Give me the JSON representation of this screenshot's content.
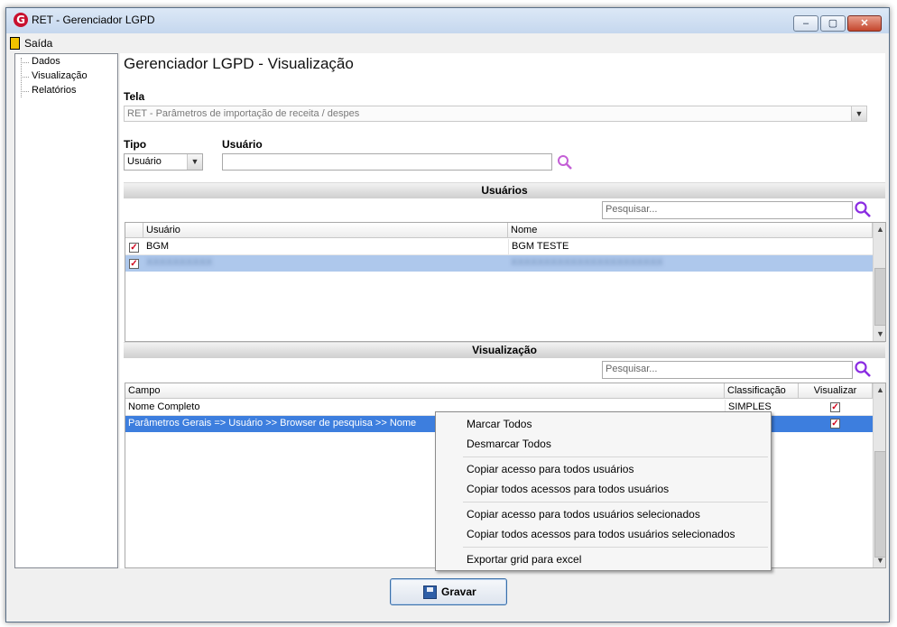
{
  "window": {
    "title": "RET - Gerenciador LGPD",
    "app_icon_letter": "G",
    "min_glyph": "–",
    "max_glyph": "▢",
    "close_glyph": "✕"
  },
  "menu": {
    "exit_label": "Saída"
  },
  "tree": {
    "items": [
      "Dados",
      "Visualização",
      "Relatórios"
    ]
  },
  "page": {
    "title": "Gerenciador LGPD - Visualização"
  },
  "tela": {
    "label": "Tela",
    "value": "RET - Parâmetros de importação de receita / despes"
  },
  "tipo": {
    "label": "Tipo",
    "value": "Usuário"
  },
  "usuario": {
    "label": "Usuário",
    "value": ""
  },
  "usuarios_section": {
    "title": "Usuários",
    "search_placeholder": "Pesquisar...",
    "columns": [
      "Usuário",
      "Nome"
    ],
    "rows": [
      {
        "checked": true,
        "usuario": "BGM",
        "nome": "BGM TESTE",
        "selected": false
      },
      {
        "checked": true,
        "usuario": "XXXXXXXXXX",
        "nome": "XXXXXXXXXXXXXXXXXXXXXXX",
        "selected": true
      }
    ]
  },
  "visualizacao_section": {
    "title": "Visualização",
    "search_placeholder": "Pesquisar...",
    "columns": [
      "Campo",
      "Classificação",
      "Visualizar"
    ],
    "rows": [
      {
        "campo": "Nome Completo",
        "classificacao": "SIMPLES",
        "visualizar": true,
        "selected": false
      },
      {
        "campo": "Parâmetros Gerais => Usuário >> Browser de pesquisa >> Nome",
        "classificacao": "",
        "visualizar": true,
        "selected": true
      }
    ]
  },
  "context_menu": {
    "items": [
      "Marcar Todos",
      "Desmarcar Todos",
      "Copiar acesso para todos usuários",
      "Copiar todos acessos para todos usuários",
      "Copiar acesso para todos usuários selecionados",
      "Copiar todos acessos para todos usuários selecionados",
      "Exportar grid para excel"
    ]
  },
  "actions": {
    "save_label": "Gravar"
  },
  "colors": {
    "selection": "#3d7ede",
    "title_bar": "#c5d7ee",
    "search_icon": "#8a2be2",
    "check_mark": "#d1001a"
  },
  "icons": {
    "search": "search-icon",
    "save": "floppy-disk-icon",
    "exit": "exit-door-icon",
    "app": "app-logo-icon"
  }
}
